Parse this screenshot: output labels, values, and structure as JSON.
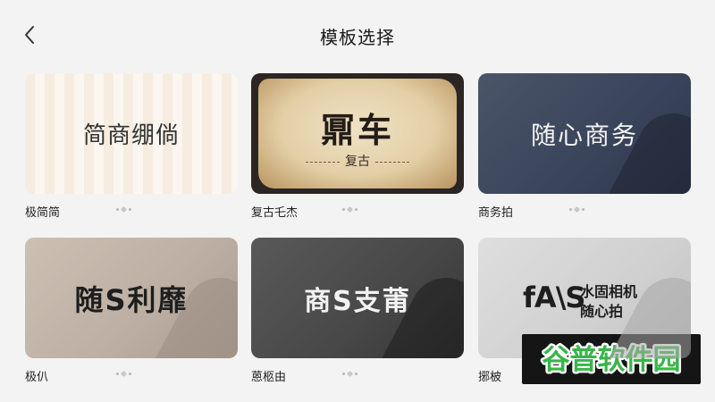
{
  "header": {
    "title": "模板选择",
    "back_icon": "chevron-left-icon"
  },
  "templates": [
    {
      "thumb_title": "简商绷倘",
      "label": "极简简"
    },
    {
      "thumb_title": "鼏车",
      "thumb_subtitle": "复古",
      "label": "复古乇杰"
    },
    {
      "thumb_title": "随心商务",
      "label": "商务拍"
    },
    {
      "thumb_title": "随S利靡",
      "label": "极仈"
    },
    {
      "thumb_title": "商S支莆",
      "label": "蒽柩由"
    },
    {
      "thumb_logo": "fA\\S",
      "thumb_line1": "水固相机",
      "thumb_line2": "随心拍",
      "label": "捓柀"
    }
  ],
  "more_icon": "more-dots-icon",
  "watermark": {
    "text": "谷普软件园",
    "colors": {
      "green": "#39b54a",
      "white": "#ffffff"
    }
  },
  "colors": {
    "background": "#f3f3f3",
    "navy": "#3f485d",
    "charcoal": "#474747",
    "taupe": "#bcaea2"
  }
}
